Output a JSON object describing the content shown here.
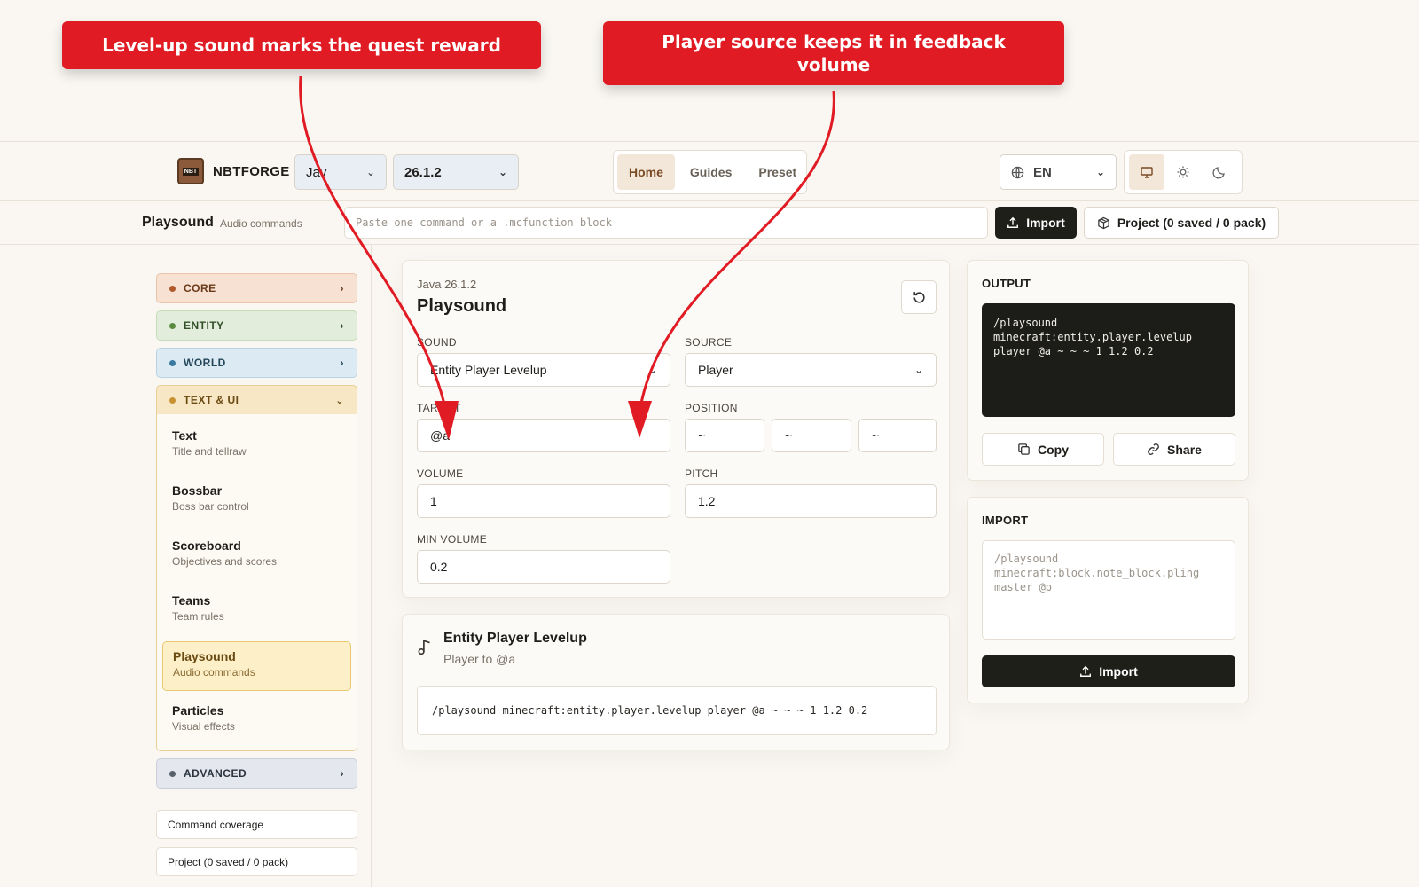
{
  "annotations": {
    "callout_1": "Level-up sound marks the quest reward",
    "callout_2": "Player source keeps it in feedback volume"
  },
  "header": {
    "brand": "NBTFORGE",
    "logo_text": "NBT",
    "edition": "Jav",
    "version": "26.1.2",
    "nav": [
      "Home",
      "Guides",
      "Preset"
    ],
    "lang": "EN"
  },
  "subbar": {
    "title": "Playsound",
    "subtitle": "Audio commands",
    "input_placeholder": "Paste one command or a .mcfunction block",
    "import_label": "Import",
    "project_label": "Project (0 saved / 0 pack)"
  },
  "sidebar": {
    "categories": {
      "core": "CORE",
      "entity": "ENTITY",
      "world": "WORLD",
      "text_ui": "TEXT & UI",
      "advanced": "ADVANCED"
    },
    "items": [
      {
        "title": "Text",
        "sub": "Title and tellraw"
      },
      {
        "title": "Bossbar",
        "sub": "Boss bar control"
      },
      {
        "title": "Scoreboard",
        "sub": "Objectives and scores"
      },
      {
        "title": "Teams",
        "sub": "Team rules"
      },
      {
        "title": "Playsound",
        "sub": "Audio commands"
      },
      {
        "title": "Particles",
        "sub": "Visual effects"
      }
    ],
    "coverage": "Command coverage",
    "project": "Project (0 saved / 0 pack)"
  },
  "form": {
    "kicker": "Java 26.1.2",
    "title": "Playsound",
    "sound_label": "SOUND",
    "sound_value": "Entity Player Levelup",
    "source_label": "SOURCE",
    "source_value": "Player",
    "target_label": "TARGET",
    "target_value": "@a",
    "position_label": "POSITION",
    "pos_x": "~",
    "pos_y": "~",
    "pos_z": "~",
    "volume_label": "VOLUME",
    "volume_value": "1",
    "pitch_label": "PITCH",
    "pitch_value": "1.2",
    "min_volume_label": "MIN VOLUME",
    "min_volume_value": "0.2"
  },
  "preview": {
    "title": "Entity Player Levelup",
    "subtitle": "Player to @a",
    "command": "/playsound minecraft:entity.player.levelup player @a ~ ~ ~ 1 1.2 0.2"
  },
  "output": {
    "heading": "OUTPUT",
    "code": "/playsound\nminecraft:entity.player.levelup\nplayer @a ~ ~ ~ 1 1.2 0.2",
    "copy_label": "Copy",
    "share_label": "Share"
  },
  "import_panel": {
    "heading": "IMPORT",
    "placeholder": "/playsound\nminecraft:block.note_block.pling\nmaster @p",
    "button_label": "Import"
  }
}
